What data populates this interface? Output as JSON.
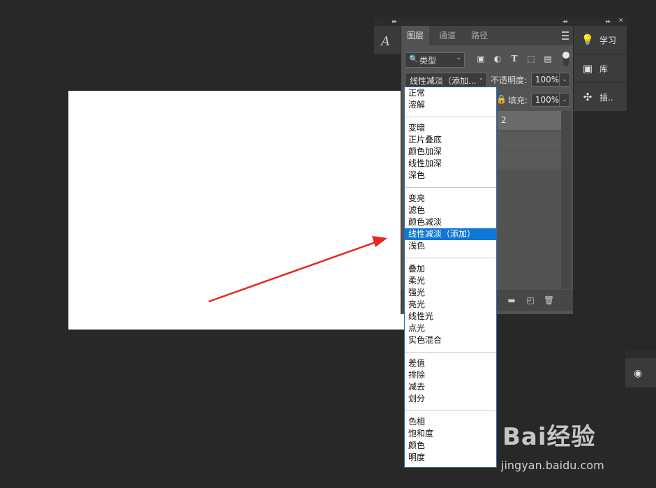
{
  "colors": {
    "canvas": "#ffffff",
    "selection": "#0f78d7",
    "arrow": "#e8251f"
  },
  "char_panel": {
    "icon": "character-panel-icon",
    "glyph": "A"
  },
  "panel_controls": {
    "collapse_left": "▸▸",
    "expand": "◂◂",
    "collapse_right": "▸▸",
    "close": "✕"
  },
  "layers_panel": {
    "tabs": [
      "图层",
      "通道",
      "路径"
    ],
    "active_tab": "图层",
    "filter_kind": "类型",
    "blend_mode": "线性减淡（添加...",
    "opacity_label": "不透明度:",
    "opacity_value": "100%",
    "fill_label": "填充:",
    "fill_value": "100%",
    "layer_name_partial": "2"
  },
  "side_panel": [
    {
      "icon": "lightbulb-icon",
      "label": "学习"
    },
    {
      "icon": "library-icon",
      "label": "库"
    },
    {
      "icon": "plugin-icon",
      "label": "插.."
    }
  ],
  "blend_dropdown": {
    "groups": [
      [
        "正常",
        "溶解"
      ],
      [
        "变暗",
        "正片叠底",
        "颜色加深",
        "线性加深",
        "深色"
      ],
      [
        "变亮",
        "滤色",
        "颜色减淡",
        "线性减淡（添加）",
        "浅色"
      ],
      [
        "叠加",
        "柔光",
        "强光",
        "亮光",
        "线性光",
        "点光",
        "实色混合"
      ],
      [
        "差值",
        "排除",
        "减去",
        "划分"
      ],
      [
        "色相",
        "饱和度",
        "颜色",
        "明度"
      ]
    ],
    "selected": "线性减淡（添加）"
  },
  "watermark": {
    "brand": "Bai经验",
    "url": "jingyan.baidu.com"
  }
}
